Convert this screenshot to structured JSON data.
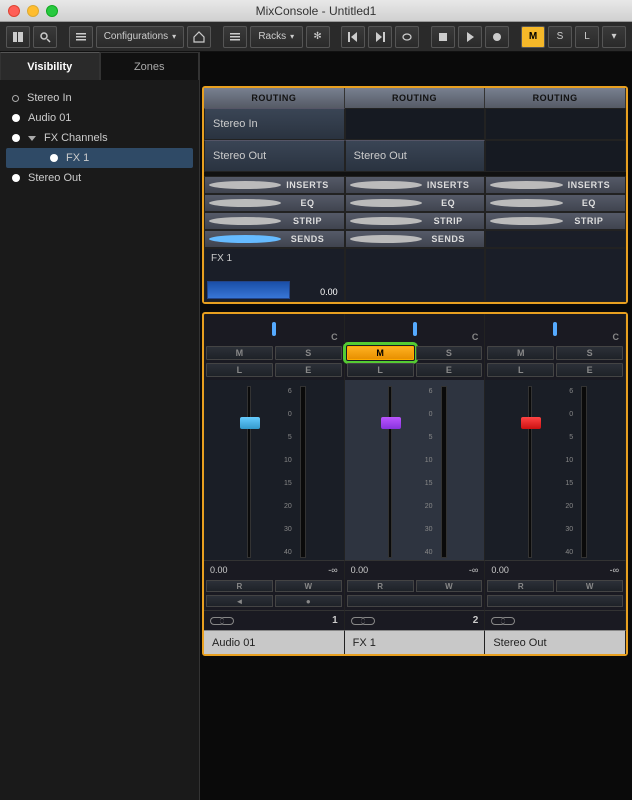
{
  "window": {
    "title": "MixConsole - Untitled1"
  },
  "toolbar": {
    "configurations": "Configurations",
    "racks": "Racks",
    "mute": "M",
    "solo": "S",
    "listen": "L"
  },
  "tabs": {
    "visibility": "Visibility",
    "zones": "Zones"
  },
  "tree": {
    "stereo_in": "Stereo In",
    "audio01": "Audio 01",
    "fx_channels": "FX Channels",
    "fx1": "FX 1",
    "stereo_out": "Stereo Out"
  },
  "racks": {
    "routing": "ROUTING",
    "inserts": "INSERTS",
    "eq": "EQ",
    "strip": "STRIP",
    "sends": "SENDS",
    "route_in_0": "Stereo In",
    "route_out_0": "Stereo Out",
    "route_out_1": "Stereo Out",
    "send0_label": "FX 1",
    "send0_value": "0.00"
  },
  "channels": [
    {
      "name": "Audio 01",
      "pan": "C",
      "mute": false,
      "fader_db": "0.00",
      "m": "M",
      "s": "S",
      "l": "L",
      "e": "E",
      "r": "R",
      "w": "W",
      "num": "1",
      "knob": "cyan",
      "peak": "-∞"
    },
    {
      "name": "FX 1",
      "pan": "C",
      "mute": true,
      "fader_db": "0.00",
      "m": "M",
      "s": "S",
      "l": "L",
      "e": "E",
      "r": "R",
      "w": "W",
      "num": "2",
      "knob": "purple",
      "peak": "-∞"
    },
    {
      "name": "Stereo Out",
      "pan": "C",
      "mute": false,
      "fader_db": "0.00",
      "m": "M",
      "s": "S",
      "l": "L",
      "e": "E",
      "r": "R",
      "w": "W",
      "num": "",
      "knob": "red",
      "peak": "-∞"
    }
  ],
  "scale": [
    "6",
    "0",
    "5",
    "10",
    "15",
    "20",
    "30",
    "40"
  ],
  "icons": {
    "speaker": "◄"
  }
}
